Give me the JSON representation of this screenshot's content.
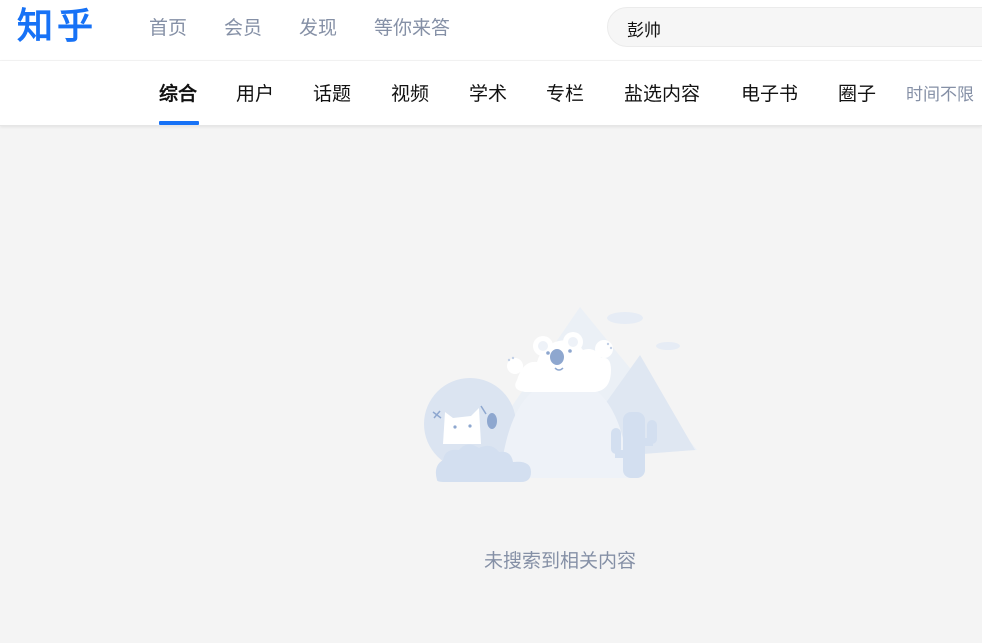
{
  "header": {
    "logo_text": "知乎",
    "nav": [
      "首页",
      "会员",
      "发现",
      "等你来答"
    ],
    "search_value": "彭帅"
  },
  "tabs": {
    "items": [
      "综合",
      "用户",
      "话题",
      "视频",
      "学术",
      "专栏",
      "盐选内容",
      "电子书",
      "圈子"
    ],
    "active": "综合",
    "time_filter": "时间不限"
  },
  "empty_state": {
    "message": "未搜索到相关内容",
    "illustration_icon": "empty-search-illustration"
  },
  "colors": {
    "brand": "#1772f6",
    "muted_text": "#8590a6",
    "body_text": "#121212",
    "page_background": "#f4f4f4",
    "illustration_light": "#ebf0f6",
    "illustration_mid": "#d3dff0",
    "illustration_dark": "#8ea7cf"
  }
}
